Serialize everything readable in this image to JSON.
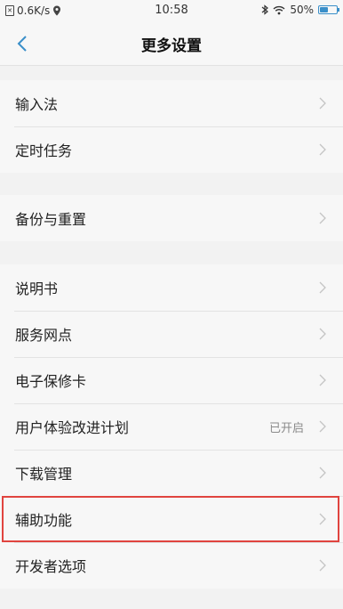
{
  "status_bar": {
    "speed": "0.6K/s",
    "time": "10:58",
    "battery": "50%",
    "battery_level": 0.5
  },
  "header": {
    "title": "更多设置",
    "back_icon": "chevron-left-icon"
  },
  "groups": [
    {
      "items": [
        {
          "label": "输入法"
        },
        {
          "label": "定时任务"
        }
      ]
    },
    {
      "items": [
        {
          "label": "备份与重置"
        }
      ]
    },
    {
      "items": [
        {
          "label": "说明书"
        },
        {
          "label": "服务网点"
        },
        {
          "label": "电子保修卡"
        },
        {
          "label": "用户体验改进计划",
          "value": "已开启"
        },
        {
          "label": "下载管理"
        },
        {
          "label": "辅助功能",
          "highlighted": true
        },
        {
          "label": "开发者选项"
        }
      ]
    }
  ],
  "colors": {
    "accent": "#3a8fc9",
    "highlight": "#e0443f"
  }
}
